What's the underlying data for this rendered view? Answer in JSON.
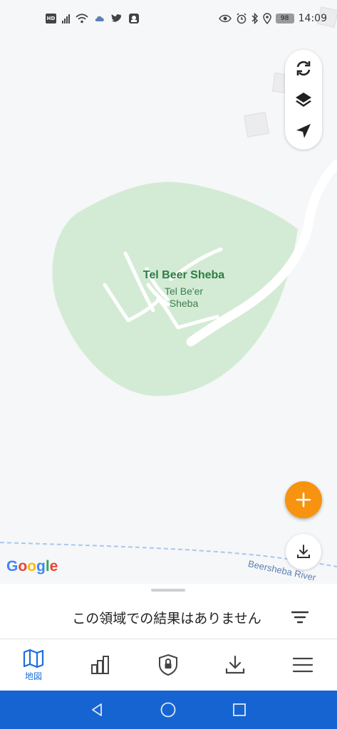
{
  "status_bar": {
    "left_icons": [
      "hd-icon",
      "signal-icon",
      "wifi-icon",
      "cloud-icon",
      "twitter-icon",
      "app-icon"
    ],
    "right_icons": [
      "eye-icon",
      "alarm-icon",
      "bluetooth-icon",
      "location-icon"
    ],
    "battery": "98",
    "time": "14:09"
  },
  "map": {
    "place_name": "Tel Beer Sheba",
    "place_name_alt_line1": "Tel Be'er",
    "place_name_alt_line2": "Sheba",
    "river_label": "Beersheba River",
    "attribution": "Google",
    "colors": {
      "background": "#f6f7f9",
      "park": "#d3ebd4",
      "road": "#ffffff",
      "river": "#a9c7ee",
      "google_blue": "#4285f4",
      "google_red": "#ea4335",
      "google_yellow": "#fbbc05",
      "google_green": "#34a853"
    }
  },
  "controls": {
    "buttons": [
      "refresh-icon",
      "layers-icon",
      "my-location-icon"
    ],
    "fab_add_color": "#f7930f",
    "fab_add_icon": "plus-icon",
    "fab_download_icon": "download-icon"
  },
  "sheet": {
    "no_results": "この領域での結果はありません",
    "filter_icon": "filter-icon"
  },
  "bottom_nav": {
    "items": [
      {
        "icon": "map-icon",
        "label": "地図",
        "active": true
      },
      {
        "icon": "stats-icon",
        "label": "",
        "active": false
      },
      {
        "icon": "lock-shield-icon",
        "label": "",
        "active": false
      },
      {
        "icon": "download-icon",
        "label": "",
        "active": false
      },
      {
        "icon": "menu-icon",
        "label": "",
        "active": false
      }
    ],
    "active_color": "#1e6fd9",
    "inactive_color": "#555555"
  },
  "system_nav": {
    "buttons": [
      "back-icon",
      "home-icon",
      "recents-icon"
    ],
    "background": "#1664d2"
  }
}
